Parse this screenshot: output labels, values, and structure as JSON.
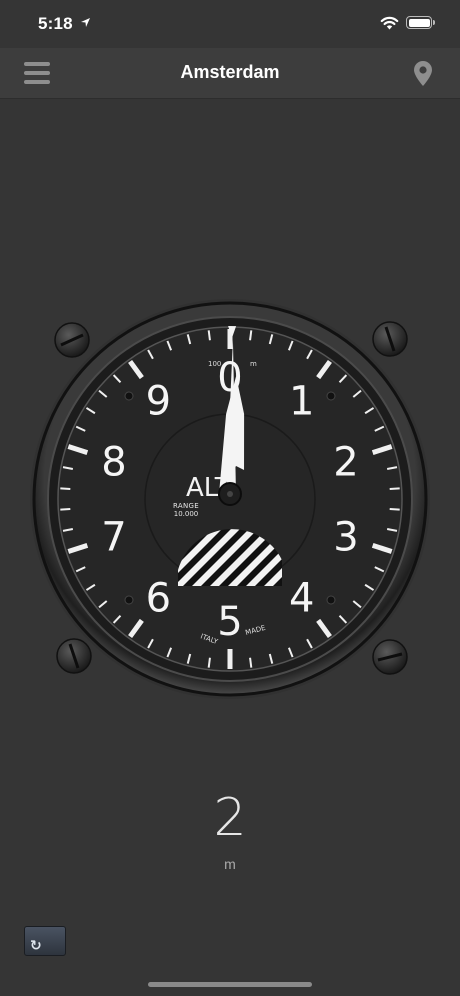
{
  "status_bar": {
    "time": "5:18"
  },
  "nav": {
    "title": "Amsterdam"
  },
  "gauge": {
    "dial_numbers": [
      "0",
      "1",
      "2",
      "3",
      "4",
      "5",
      "6",
      "7",
      "8",
      "9"
    ],
    "label": "ALT",
    "range_label": "RANGE",
    "range_value": "10.000",
    "scale_mark": "100",
    "scale_unit": "m",
    "maker_left": "ITALY",
    "maker_right": "MADE",
    "needle_value": 2,
    "needle_max": 10000
  },
  "readout": {
    "value": "2",
    "unit": "m"
  },
  "icons": {
    "menu": "hamburger-menu-icon",
    "pin": "location-pin-icon",
    "reset": "reset-icon",
    "status_location": "location-arrow-icon",
    "wifi": "wifi-icon",
    "battery": "battery-icon"
  },
  "colors": {
    "background": "#353535",
    "nav_background": "#3d3d3d",
    "dial_face": "#262626",
    "bezel": "#2a2a2a",
    "needle": "#ffffff"
  }
}
